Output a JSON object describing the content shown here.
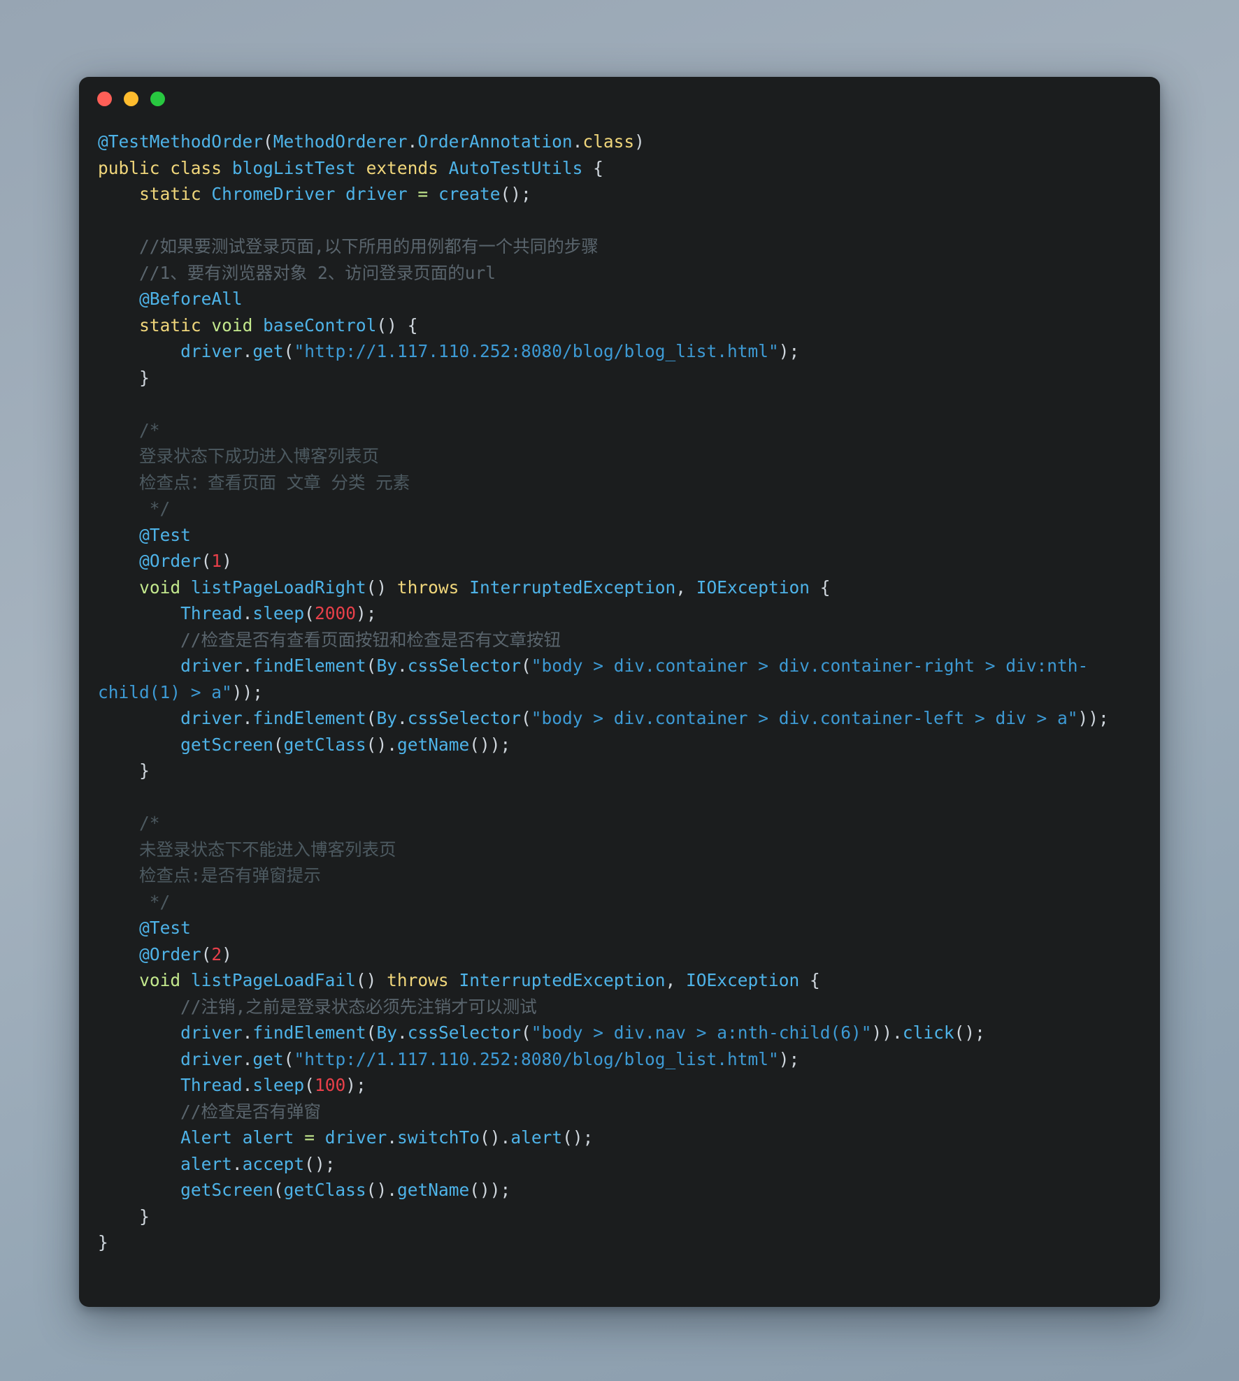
{
  "window": {
    "title": "",
    "traffic_lights": [
      {
        "name": "close-button",
        "color": "#ff5f57"
      },
      {
        "name": "minimize-button",
        "color": "#febc2e"
      },
      {
        "name": "maximize-button",
        "color": "#28c840"
      }
    ]
  },
  "theme": {
    "background": "#1b1d1e",
    "desktop": "#9aa7b4",
    "keyword": "#f0d67b",
    "keyword_green": "#c3e88d",
    "type": "#4eb3e8",
    "string": "#3d9ad4",
    "number": "#e8404a",
    "punctuation": "#cfd6dd",
    "comment": "#5a656d"
  },
  "code": {
    "language": "java",
    "lines": [
      "@TestMethodOrder(MethodOrderer.OrderAnnotation.class)",
      "public class blogListTest extends AutoTestUtils {",
      "    static ChromeDriver driver = create();",
      "",
      "    //如果要测试登录页面,以下所用的用例都有一个共同的步骤",
      "    //1、要有浏览器对象 2、访问登录页面的url",
      "    @BeforeAll",
      "    static void baseControl() {",
      "        driver.get(\"http://1.117.110.252:8080/blog/blog_list.html\");",
      "    }",
      "",
      "    /*",
      "    登录状态下成功进入博客列表页",
      "    检查点：查看页面 文章 分类 元素",
      "     */",
      "    @Test",
      "    @Order(1)",
      "    void listPageLoadRight() throws InterruptedException, IOException {",
      "        Thread.sleep(2000);",
      "        //检查是否有查看页面按钮和检查是否有文章按钮",
      "        driver.findElement(By.cssSelector(\"body > div.container > div.container-right > div:nth-child(1) > a\"));",
      "        driver.findElement(By.cssSelector(\"body > div.container > div.container-left > div > a\"));",
      "        getScreen(getClass().getName());",
      "    }",
      "",
      "    /*",
      "    未登录状态下不能进入博客列表页",
      "    检查点:是否有弹窗提示",
      "     */",
      "    @Test",
      "    @Order(2)",
      "    void listPageLoadFail() throws InterruptedException, IOException {",
      "        //注销,之前是登录状态必须先注销才可以测试",
      "        driver.findElement(By.cssSelector(\"body > div.nav > a:nth-child(6)\")).click();",
      "        driver.get(\"http://1.117.110.252:8080/blog/blog_list.html\");",
      "        Thread.sleep(100);",
      "        //检查是否有弹窗",
      "        Alert alert = driver.switchTo().alert();",
      "        alert.accept();",
      "        getScreen(getClass().getName());",
      "    }",
      "}"
    ]
  }
}
